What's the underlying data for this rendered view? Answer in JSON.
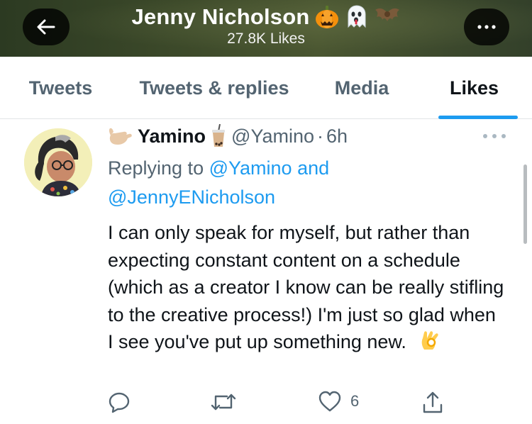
{
  "header": {
    "name": "Jenny Nicholson",
    "name_emojis": [
      "pumpkin-icon",
      "ghost-icon",
      "bat-icon"
    ],
    "likes_count": "27.8K Likes",
    "back_icon": "arrow-left-icon",
    "more_icon": "more-dots-icon"
  },
  "tabs": [
    {
      "label": "Tweets",
      "active": false
    },
    {
      "label": "Tweets & replies",
      "active": false
    },
    {
      "label": "Media",
      "active": false
    },
    {
      "label": "Likes",
      "active": true
    }
  ],
  "tweet": {
    "display_name": "Yamino",
    "name_emojis": [
      "call-me-hand-icon",
      "bubble-tea-icon"
    ],
    "handle": "@Yamino",
    "separator": "·",
    "time": "6h",
    "replying_prefix": "Replying to",
    "replying_to_1": "@Yamino",
    "replying_and": "and",
    "replying_to_2": "@JennyENicholson",
    "body": "I can only speak for myself, but rather than expecting constant content on a schedule (which as a creator I know can be really stifling to the creative process!) I'm just so glad when I see you've put up something new.",
    "body_emoji": "ok-hand-icon",
    "like_count": "6",
    "accent": "#1d9bf0"
  }
}
